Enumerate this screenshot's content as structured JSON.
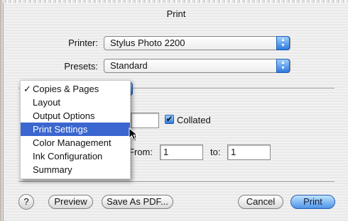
{
  "window": {
    "title": "Print"
  },
  "printer": {
    "label": "Printer:",
    "value": "Stylus Photo 2200"
  },
  "presets": {
    "label": "Presets:",
    "value": "Standard"
  },
  "pane_menu": {
    "items": [
      {
        "label": "Copies & Pages",
        "checked": true,
        "selected": false
      },
      {
        "label": "Layout",
        "checked": false,
        "selected": false
      },
      {
        "label": "Output Options",
        "checked": false,
        "selected": false
      },
      {
        "label": "Print Settings",
        "checked": false,
        "selected": true
      },
      {
        "label": "Color Management",
        "checked": false,
        "selected": false
      },
      {
        "label": "Ink Configuration",
        "checked": false,
        "selected": false
      },
      {
        "label": "Summary",
        "checked": false,
        "selected": false
      }
    ],
    "check_mark": "✓"
  },
  "copies": {
    "value": ""
  },
  "collated": {
    "label": "Collated",
    "checked": true,
    "check_glyph": "✔"
  },
  "pages": {
    "partial_text": "ll",
    "from_label": "From:",
    "from_value": "1",
    "to_label": "to:",
    "to_value": "1"
  },
  "buttons": {
    "help": "?",
    "preview": "Preview",
    "save_pdf": "Save As PDF...",
    "cancel": "Cancel",
    "print": "Print"
  },
  "icons": {
    "help": "question-mark-icon",
    "popup_arrows": "updown-arrows-icon",
    "cursor": "mouse-pointer-icon"
  },
  "colors": {
    "accent": "#3a66cf",
    "aqua": "#2d79db"
  }
}
